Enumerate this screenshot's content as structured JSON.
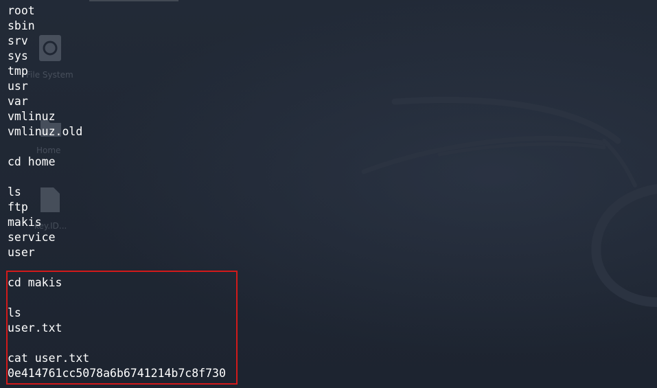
{
  "terminal": {
    "lines": [
      "root",
      "sbin",
      "srv",
      "sys",
      "tmp",
      "usr",
      "var",
      "vmlinuz",
      "vmlinuz.old",
      "",
      "cd home",
      "",
      "ls",
      "ftp",
      "makis",
      "service",
      "user",
      "",
      "cd makis",
      "",
      "ls",
      "user.txt",
      "",
      "cat user.txt",
      "0e414761cc5078a6b6741214b7c8f730"
    ]
  },
  "desktop": {
    "icons": [
      {
        "label": "File System",
        "icon": "drive-icon"
      },
      {
        "label": "Home",
        "icon": "folder-icon"
      },
      {
        "label": "key.ID...",
        "icon": "file-icon"
      }
    ]
  },
  "colors": {
    "background": "#1f2532",
    "text": "#ffffff",
    "highlight_border": "#d31a1a"
  }
}
